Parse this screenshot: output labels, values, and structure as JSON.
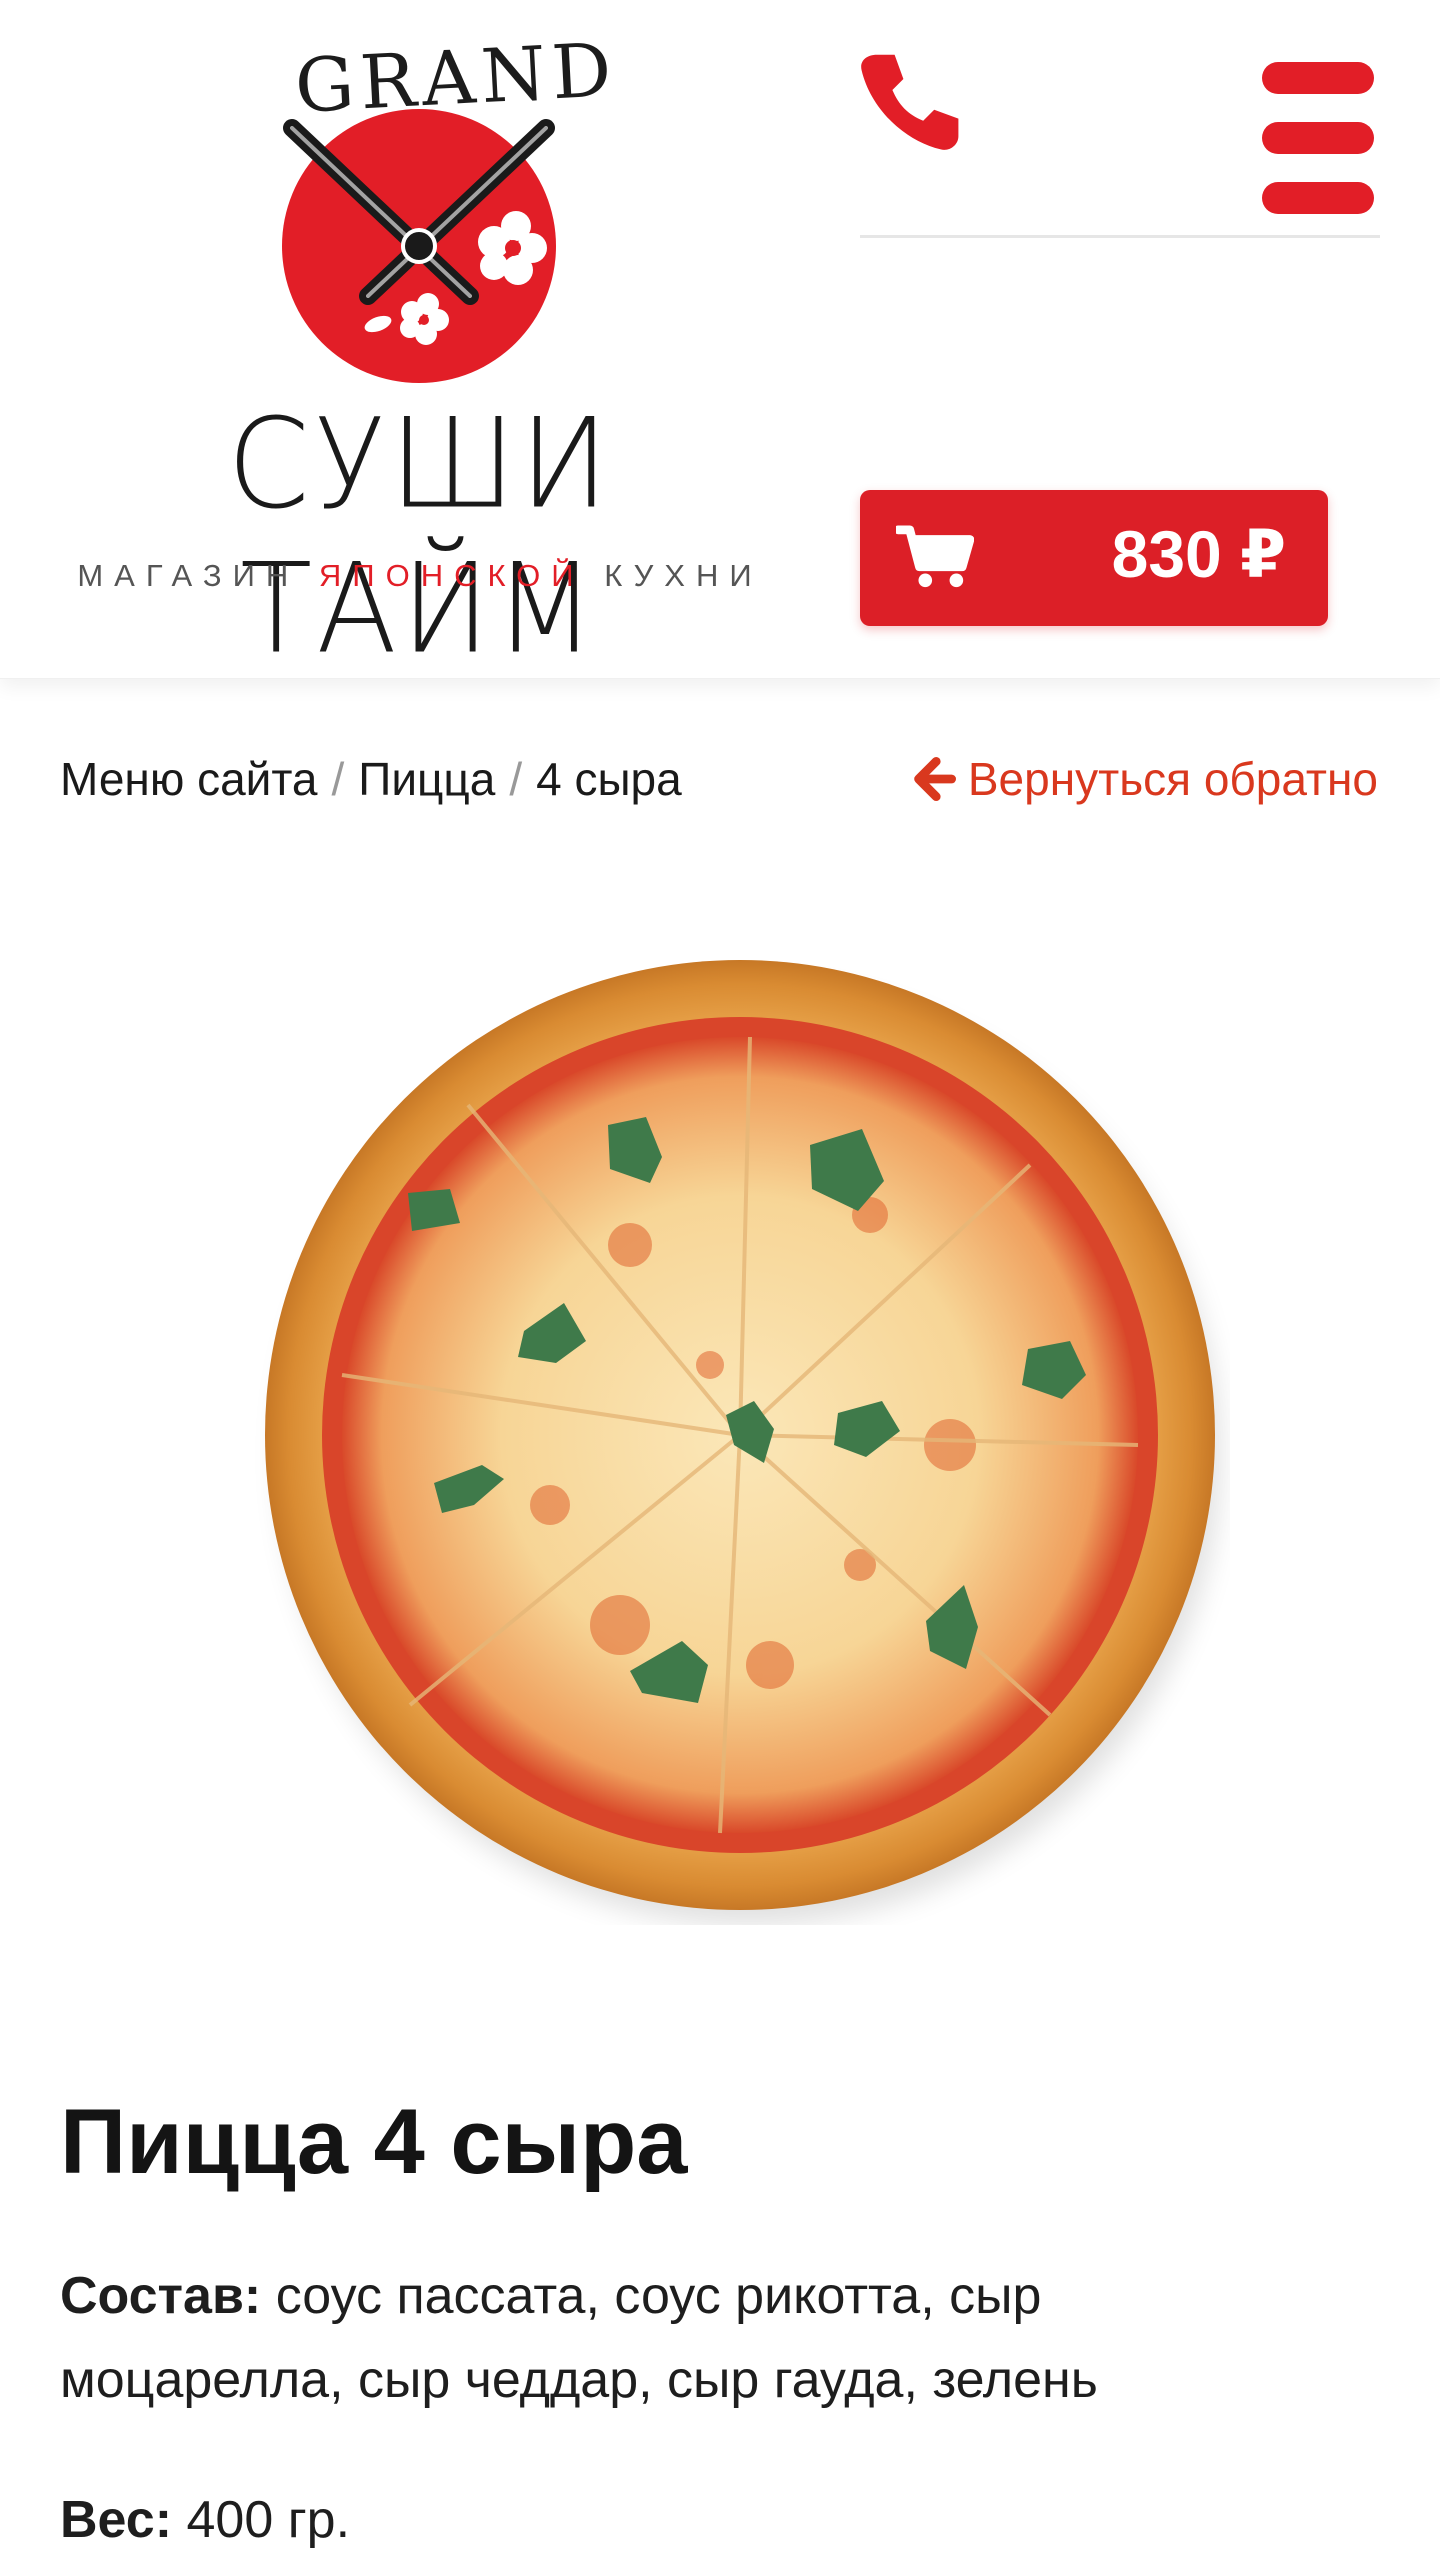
{
  "logo": {
    "brand_top": "GRAND",
    "brand_name": "СУШИ ТАЙМ",
    "tagline_part1": "МАГАЗИН",
    "tagline_accent": "ЯПОНСКОЙ",
    "tagline_part2": "КУХНИ"
  },
  "header": {
    "phone_icon": "phone-icon",
    "menu_icon": "hamburger-icon",
    "cart": {
      "icon": "cart-icon",
      "price": "830 ₽"
    }
  },
  "breadcrumb": {
    "items": [
      "Меню сайта",
      "Пицца",
      "4 сыра"
    ],
    "separator": "/",
    "back_label": "Вернуться обратно",
    "back_icon": "arrow-left-icon"
  },
  "product": {
    "image": "pizza-4-cheese-photo",
    "title": "Пицца 4 сыра",
    "composition_label": "Состав:",
    "composition_text": "соус пассата, соус рикотта, сыр моцарелла, сыр чеддар, сыр гауда, зелень",
    "weight_label": "Вес:",
    "weight_value": "400 гр."
  },
  "colors": {
    "accent": "#e21e27",
    "link": "#d9381e",
    "text": "#141414"
  }
}
